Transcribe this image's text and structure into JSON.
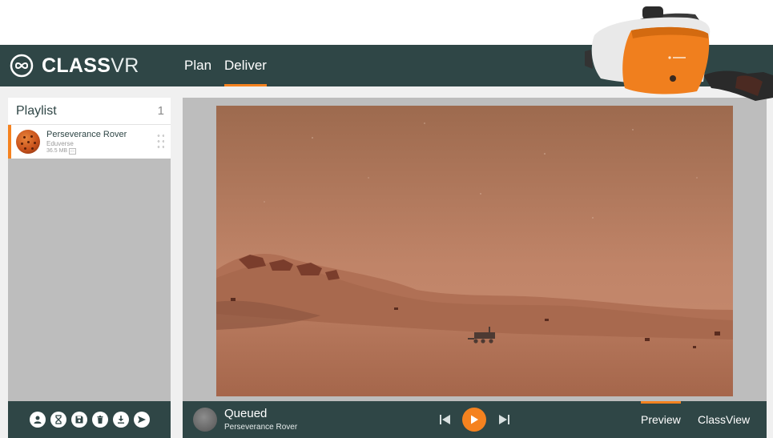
{
  "app": {
    "logo_bold": "CLASS",
    "logo_light": "VR"
  },
  "nav": [
    {
      "label": "Plan",
      "active": false
    },
    {
      "label": "Deliver",
      "active": true
    }
  ],
  "playlist": {
    "title": "Playlist",
    "count": "1",
    "items": [
      {
        "name": "Perseverance Rover",
        "source": "Eduverse",
        "size": "36.5 MB"
      }
    ]
  },
  "toolbar_icons": [
    "user-icon",
    "hourglass-icon",
    "save-icon",
    "trash-icon",
    "download-icon",
    "send-icon"
  ],
  "player": {
    "status": "Queued",
    "item": "Perseverance Rover",
    "tabs": [
      {
        "label": "Preview",
        "active": true
      },
      {
        "label": "ClassView",
        "active": false
      }
    ]
  },
  "colors": {
    "header": "#2f4646",
    "accent": "#f5821f",
    "panel": "#bdbdbd",
    "background": "#f0f0f0"
  }
}
